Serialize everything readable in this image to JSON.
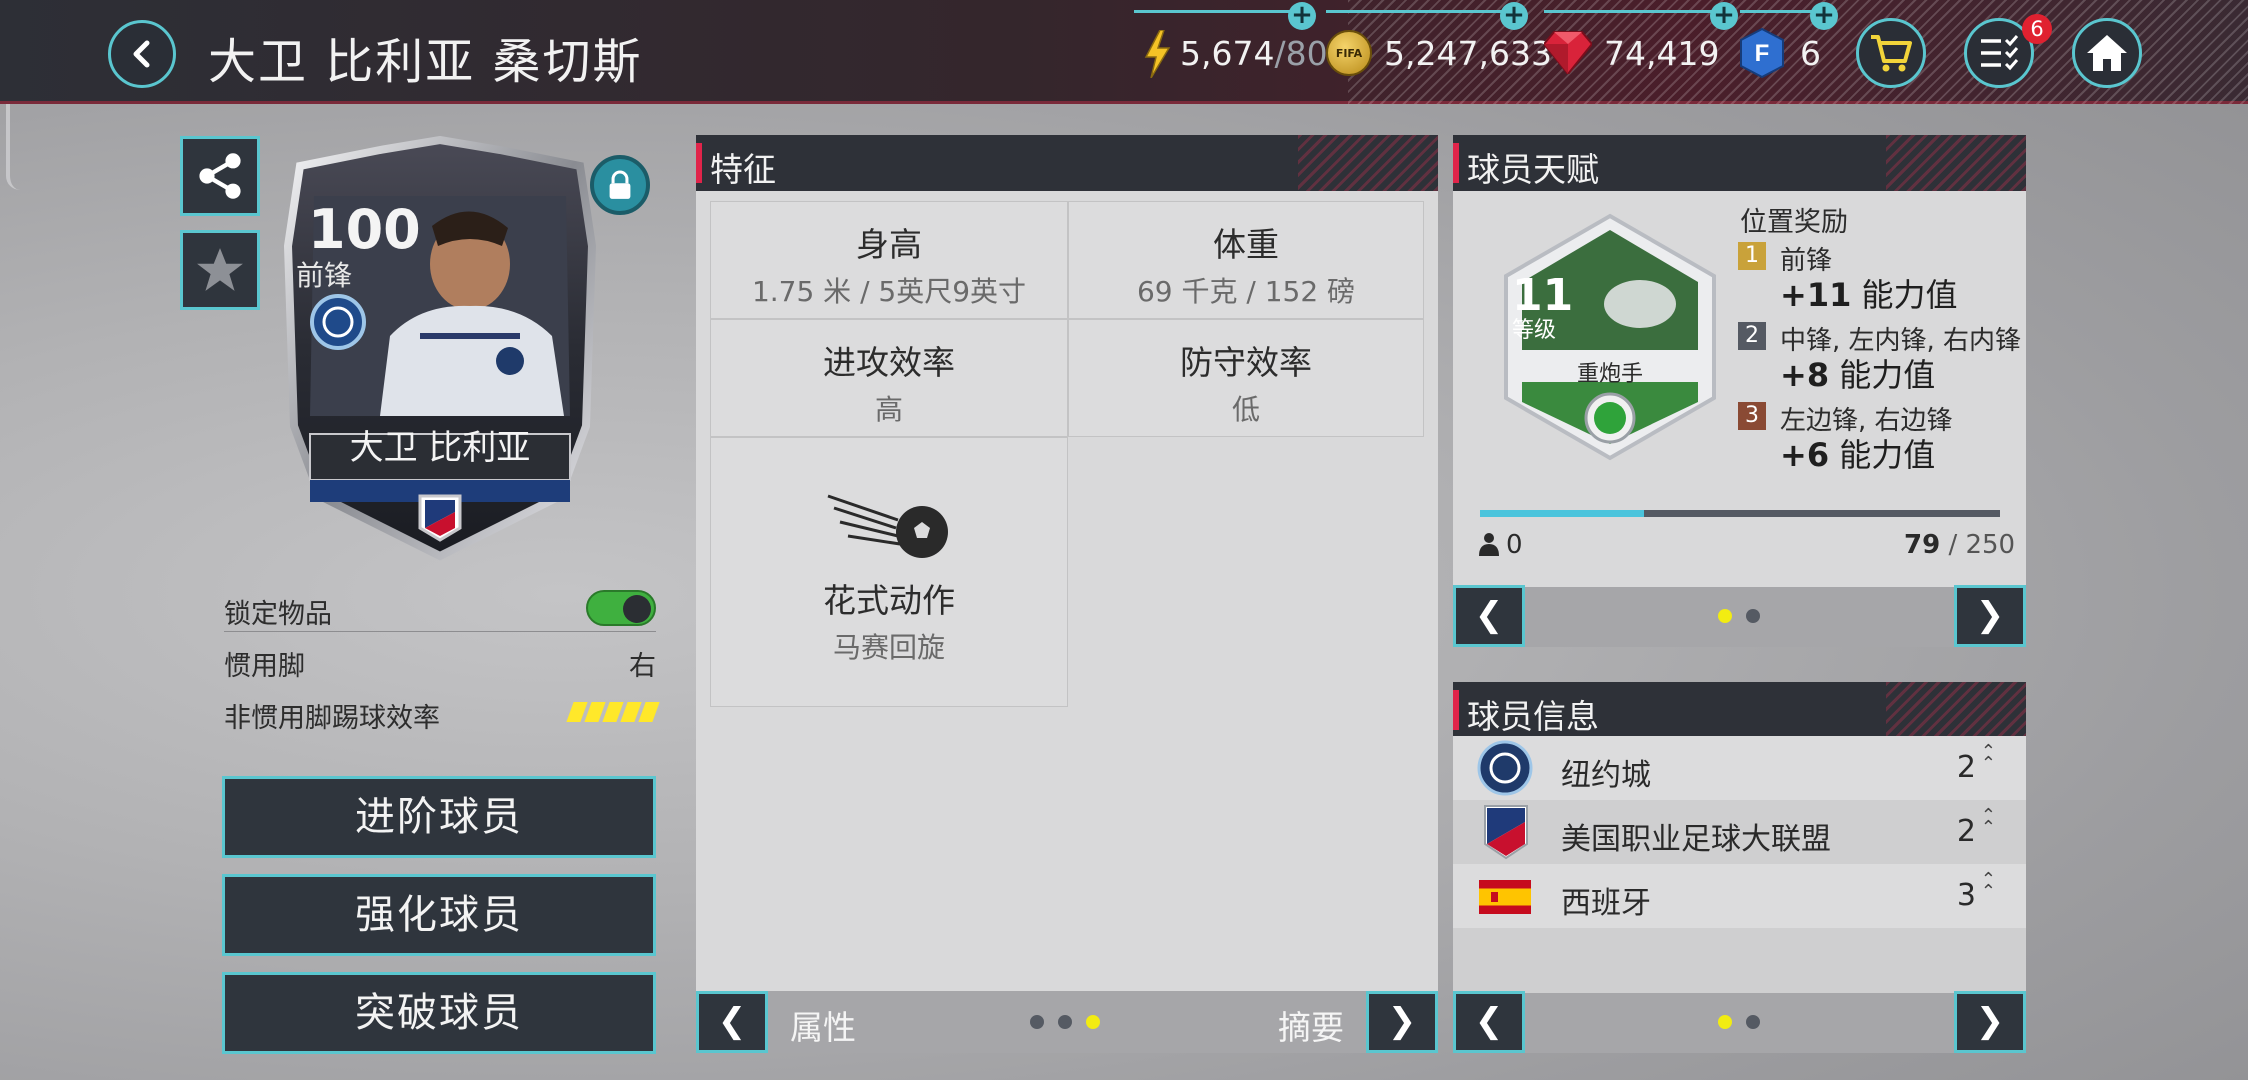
{
  "header": {
    "title": "大卫 比利亚 桑切斯",
    "energy": {
      "value": "5,674",
      "max": "/80"
    },
    "coins": "5,247,633",
    "gems": "74,419",
    "fifa_points": "6",
    "notifications": "6",
    "coin_icon_text": "FIFA"
  },
  "player_card": {
    "rating": "100",
    "position": "前锋",
    "name": "大卫 比利亚"
  },
  "left_props": {
    "lock_label": "锁定物品",
    "lock_on": true,
    "foot_label": "惯用脚",
    "foot_value": "右",
    "weak_foot_label": "非惯用脚踢球效率",
    "weak_foot_stars": 5
  },
  "actions": [
    "进阶球员",
    "强化球员",
    "突破球员"
  ],
  "traits": {
    "heading": "特征",
    "height_label": "身高",
    "height_value": "1.75 米 / 5英尺9英寸",
    "weight_label": "体重",
    "weight_value": "69 千克 / 152 磅",
    "attack_label": "进攻效率",
    "attack_value": "高",
    "defense_label": "防守效率",
    "defense_value": "低",
    "skill_label": "花式动作",
    "skill_value": "马赛回旋",
    "nav_prev_label": "属性",
    "nav_next_label": "摘要"
  },
  "talent": {
    "heading": "球员天赋",
    "level": "11",
    "level_label": "等级",
    "skill_name": "重炮手",
    "bonus_title": "位置奖励",
    "bonuses": [
      {
        "rank": "1",
        "positions": "前锋",
        "bonus": "+11",
        "unit": "能力值",
        "color": "#c9a23a"
      },
      {
        "rank": "2",
        "positions": "中锋, 左内锋, 右内锋",
        "bonus": "+8",
        "unit": "能力值",
        "color": "#555a63"
      },
      {
        "rank": "3",
        "positions": "左边锋, 右边锋",
        "bonus": "+6",
        "unit": "能力值",
        "color": "#8a4a34"
      }
    ],
    "trainers": "0",
    "xp_current": "79",
    "xp_total": "/ 250",
    "xp_fraction": 0.316
  },
  "info": {
    "heading": "球员信息",
    "rows": [
      {
        "name": "纽约城",
        "count": "2"
      },
      {
        "name": "美国职业足球大联盟",
        "count": "2"
      },
      {
        "name": "西班牙",
        "count": "3"
      }
    ]
  },
  "colors": {
    "accent": "#5ac6cf",
    "active_dot": "#f2ec12",
    "toggle_on": "#3fb03f"
  }
}
